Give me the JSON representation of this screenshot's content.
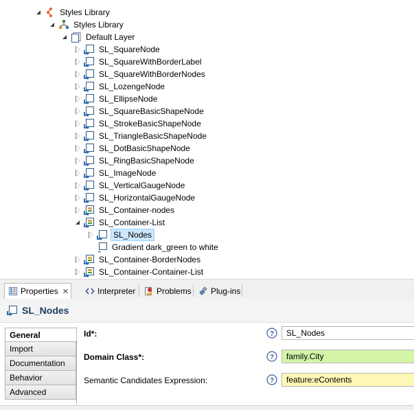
{
  "tree": {
    "rows": [
      {
        "label": "Styles Library",
        "icon": "sirius-group-icon",
        "twisty": "expanded"
      },
      {
        "label": "Styles Library",
        "icon": "viewpoint-icon",
        "twisty": "expanded"
      },
      {
        "label": "Default Layer",
        "icon": "layer-icon",
        "twisty": "expanded"
      },
      {
        "label": "SL_SquareNode",
        "icon": "node-mapping-icon",
        "twisty": "collapsed"
      },
      {
        "label": "SL_SquareWithBorderLabel",
        "icon": "node-mapping-icon",
        "twisty": "collapsed"
      },
      {
        "label": "SL_SquareWithBorderNodes",
        "icon": "node-mapping-icon",
        "twisty": "collapsed"
      },
      {
        "label": "SL_LozengeNode",
        "icon": "node-mapping-icon",
        "twisty": "collapsed"
      },
      {
        "label": "SL_EllipseNode",
        "icon": "node-mapping-icon",
        "twisty": "collapsed"
      },
      {
        "label": "SL_SquareBasicShapeNode",
        "icon": "node-mapping-icon",
        "twisty": "collapsed"
      },
      {
        "label": "SL_StrokeBasicShapeNode",
        "icon": "node-mapping-icon",
        "twisty": "collapsed"
      },
      {
        "label": "SL_TriangleBasicShapeNode",
        "icon": "node-mapping-icon",
        "twisty": "collapsed"
      },
      {
        "label": "SL_DotBasicShapeNode",
        "icon": "node-mapping-icon",
        "twisty": "collapsed"
      },
      {
        "label": "SL_RingBasicShapeNode",
        "icon": "node-mapping-icon",
        "twisty": "collapsed"
      },
      {
        "label": "SL_ImageNode",
        "icon": "node-mapping-icon",
        "twisty": "collapsed"
      },
      {
        "label": "SL_VerticalGaugeNode",
        "icon": "node-mapping-icon",
        "twisty": "collapsed"
      },
      {
        "label": "SL_HorizontalGaugeNode",
        "icon": "node-mapping-icon",
        "twisty": "collapsed"
      },
      {
        "label": "SL_Container-nodes",
        "icon": "container-mapping-icon",
        "twisty": "collapsed"
      },
      {
        "label": "SL_Container-List",
        "icon": "container-mapping-icon",
        "twisty": "expanded"
      },
      {
        "label": "SL_Nodes",
        "icon": "node-mapping-icon",
        "twisty": "collapsed",
        "selected": true
      },
      {
        "label": "Gradient  dark_green to white",
        "icon": "gradient-style-icon",
        "twisty": "none"
      },
      {
        "label": "SL_Container-BorderNodes",
        "icon": "container-mapping-icon",
        "twisty": "collapsed"
      },
      {
        "label": "SL_Container-Container-List",
        "icon": "container-mapping-icon",
        "twisty": "collapsed"
      }
    ]
  },
  "view_tabs": [
    {
      "label": "Properties",
      "icon": "properties-icon",
      "active": true,
      "close": "✕"
    },
    {
      "label": "Interpreter",
      "icon": "interpreter-icon",
      "active": false
    },
    {
      "label": "Problems",
      "icon": "problems-icon",
      "active": false
    },
    {
      "label": "Plug-ins",
      "icon": "plugins-icon",
      "active": false
    }
  ],
  "properties": {
    "title": "SL_Nodes",
    "title_icon": "node-mapping-icon",
    "sections": [
      "General",
      "Import",
      "Documentation",
      "Behavior",
      "Advanced"
    ],
    "active_section": "General",
    "fields": [
      {
        "label": "Id*:",
        "value": "SL_Nodes",
        "style": "plain",
        "bold": true
      },
      {
        "label": "Domain Class*:",
        "value": "family.City",
        "style": "green",
        "bold": true
      },
      {
        "label": "Semantic Candidates Expression:",
        "value": "feature:eContents",
        "style": "yellow",
        "bold": false
      }
    ]
  },
  "colors": {
    "selection_bg": "#cce8ff",
    "required_field": "#d4f5a8",
    "expression_field": "#fdf8b6",
    "header_title": "#1f3a63"
  }
}
